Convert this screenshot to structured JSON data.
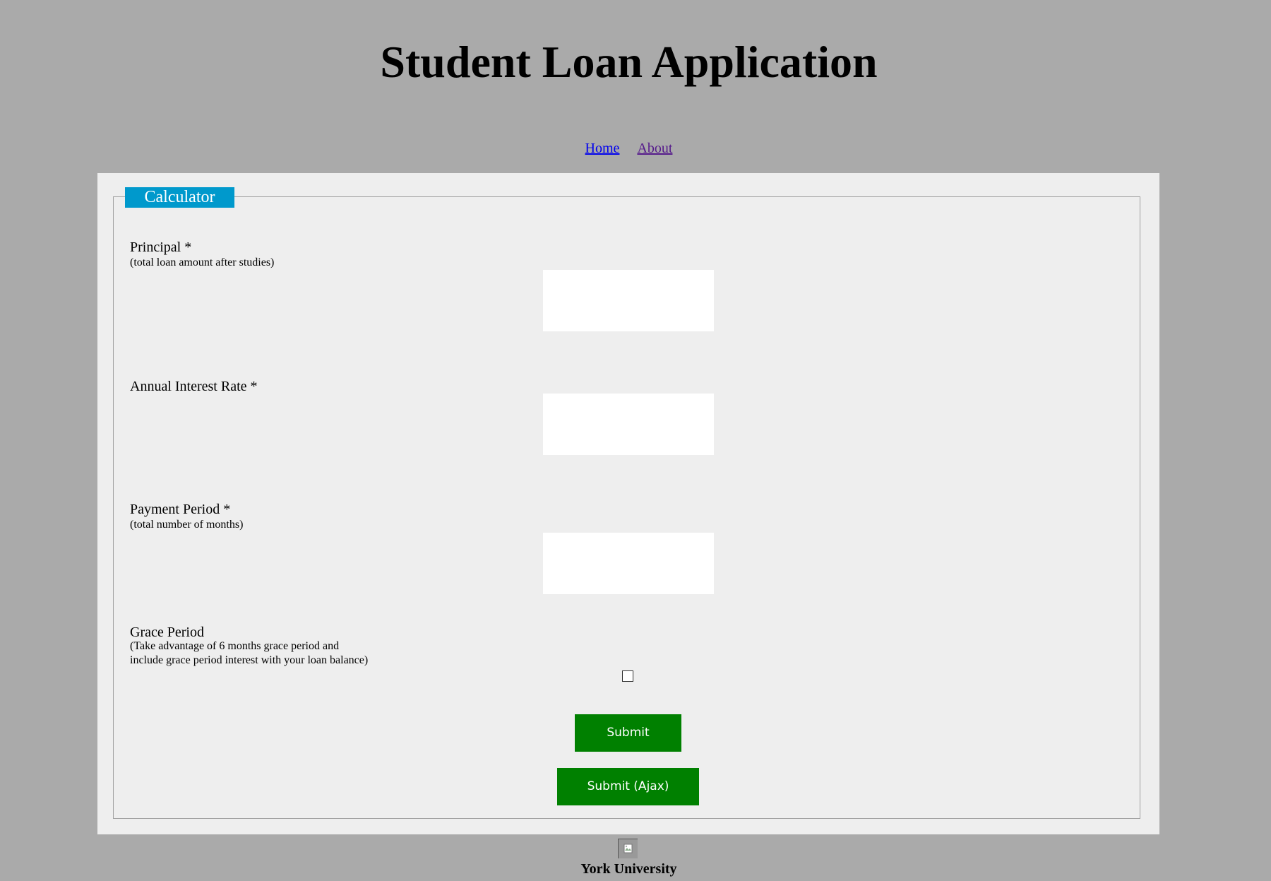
{
  "header": {
    "title": "Student Loan Application"
  },
  "nav": {
    "home": "Home",
    "about": "About"
  },
  "form": {
    "legend": "Calculator",
    "principal": {
      "label": "Principal *",
      "hint": "(total loan amount after studies)",
      "value": ""
    },
    "interest": {
      "label": "Annual Interest Rate *",
      "value": ""
    },
    "period": {
      "label": "Payment Period *",
      "hint": "(total number of months)",
      "value": ""
    },
    "grace": {
      "label": "Grace Period",
      "hint_line1": "(Take advantage of 6 months grace period and",
      "hint_line2": "include grace period interest with your loan balance)",
      "checked": false
    },
    "submit_label": "Submit",
    "submit_ajax_label": "Submit (Ajax)"
  },
  "footer": {
    "logo_icon": "broken-image-icon",
    "name": "York University"
  },
  "colors": {
    "background": "#aaaaaa",
    "panel": "#eeeeee",
    "legend": "#0099cc",
    "button": "#008000",
    "link": "#0000ee",
    "visited_link": "#551a8b"
  }
}
